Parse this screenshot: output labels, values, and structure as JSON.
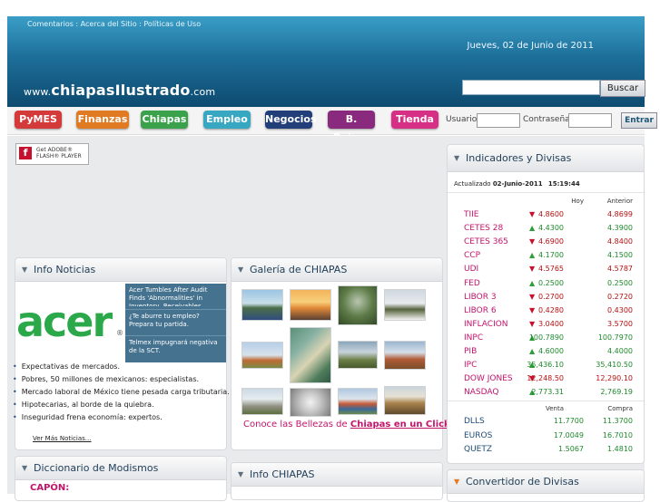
{
  "header": {
    "toplinks": [
      "Comentarios",
      "Acerca del Sitio",
      "Políticas de Uso"
    ],
    "date": "Jueves, 02 de Junio de 2011",
    "logo_prefix": "www.",
    "logo_name": "chiapasIlustrado",
    "logo_suffix": ".com",
    "search_button": "Buscar"
  },
  "nav": {
    "items": [
      {
        "label": "PyMES",
        "color": "#d43a3a"
      },
      {
        "label": "Finanzas",
        "color": "#e07b23"
      },
      {
        "label": "Chiapas",
        "color": "#3aa24a"
      },
      {
        "label": "Empleo",
        "color": "#37a7c2"
      },
      {
        "label": "Negocios",
        "color": "#233f7a"
      },
      {
        "label": "B. Raices",
        "color": "#8a2a7e"
      },
      {
        "label": "Tienda",
        "color": "#d72f86"
      }
    ],
    "usuario_label": "Usuario",
    "password_label": "Contraseña",
    "login_button": "Entrar"
  },
  "flash": {
    "line1": "Get ADOBE®",
    "line2": "FLASH® PLAYER"
  },
  "news": {
    "title": "Info Noticias",
    "logo_text": "acer",
    "side_items": [
      "Acer Tumbles After Audit Finds 'Abnormalities' in Inventory, Receivables",
      "¿Te aburre tu empleo? Prepara tu partida.",
      "Telmex impugnará negativa de la SCT."
    ],
    "list": [
      "Expectativas de mercados.",
      "Pobres, 50 millones de mexicanos: especialistas.",
      "Mercado laboral de México tiene pesada carga tributaria.",
      "Hipotecarias, al borde de la quiebra.",
      "Inseguridad frena economía: expertos."
    ],
    "more": "Ver Más Noticias..."
  },
  "gallery": {
    "title": "Galería de CHIAPAS",
    "caption_plain": "Conoce las Bellezas de ",
    "caption_link": "Chiapas en un Click"
  },
  "dictionary": {
    "title": "Diccionario de Modismos",
    "word": "CAPÓN:"
  },
  "info_chiapas": {
    "title": "Info CHIAPAS"
  },
  "indicators": {
    "title": "Indicadores y Divisas",
    "updated_label": "Actualizado",
    "updated_date": "02-Junio-2011",
    "updated_time": "15:19:44",
    "col_hoy": "Hoy",
    "col_anterior": "Anterior",
    "rows": [
      {
        "name": "TIIE",
        "dir": "down",
        "hoy": "4.8600",
        "anterior": "4.8699"
      },
      {
        "name": "CETES 28",
        "dir": "up",
        "hoy": "4.4300",
        "anterior": "4.3900"
      },
      {
        "name": "CETES 365",
        "dir": "down",
        "hoy": "4.6900",
        "anterior": "4.8400"
      },
      {
        "name": "CCP",
        "dir": "up",
        "hoy": "4.1700",
        "anterior": "4.1500"
      },
      {
        "name": "UDI",
        "dir": "down",
        "hoy": "4.5765",
        "anterior": "4.5787"
      },
      {
        "name": "FED",
        "dir": "up",
        "hoy": "0.2500",
        "anterior": "0.2500"
      },
      {
        "name": "LIBOR 3",
        "dir": "down",
        "hoy": "0.2700",
        "anterior": "0.2720"
      },
      {
        "name": "LIBOR 6",
        "dir": "down",
        "hoy": "0.4280",
        "anterior": "0.4300"
      },
      {
        "name": "INFLACION",
        "dir": "down",
        "hoy": "3.0400",
        "anterior": "3.5700"
      },
      {
        "name": "INPC",
        "dir": "up",
        "hoy": "100.7890",
        "anterior": "100.7970"
      },
      {
        "name": "PIB",
        "dir": "up",
        "hoy": "4.6000",
        "anterior": "4.4000"
      },
      {
        "name": "IPC",
        "dir": "up",
        "hoy": "35,436.10",
        "anterior": "35,410.50"
      },
      {
        "name": "DOW JONES",
        "dir": "down",
        "hoy": "12,248.50",
        "anterior": "12,290.10"
      },
      {
        "name": "NASDAQ",
        "dir": "up",
        "hoy": "2,773.31",
        "anterior": "2,769.19"
      }
    ],
    "col_venta": "Venta",
    "col_compra": "Compra",
    "currencies": [
      {
        "name": "DLLS",
        "venta": "11.7700",
        "compra": "11.3700"
      },
      {
        "name": "EUROS",
        "venta": "17.0049",
        "compra": "16.7010"
      },
      {
        "name": "QUETZ",
        "venta": "1.5067",
        "compra": "1.4810"
      }
    ]
  },
  "converter": {
    "title": "Convertidor de Divisas"
  },
  "colors": {
    "up": "#2f9e3a",
    "down": "#c8102e",
    "value_green": "#1d8a2b",
    "value_red": "#b71010"
  }
}
